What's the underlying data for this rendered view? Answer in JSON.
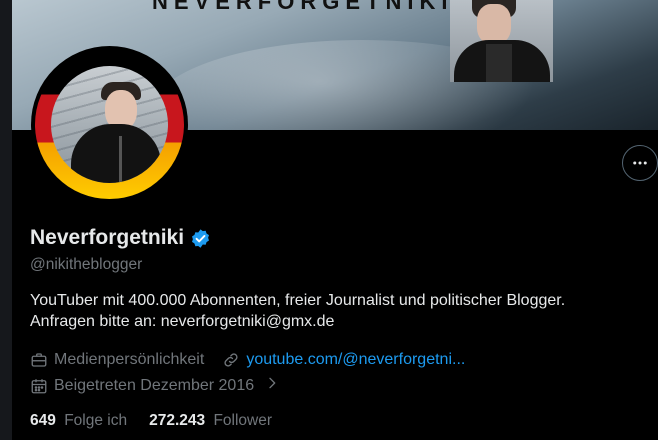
{
  "banner": {
    "text": "NEVERFORGETNIKI"
  },
  "profile": {
    "name": "Neverforgetniki",
    "verified": true,
    "handle": "@nikitheblogger",
    "bio_line1": "YouTuber mit 400.000 Abonnenten, freier Journalist und politischer Blogger.",
    "bio_line2": "Anfragen bitte an: neverforgetniki@gmx.de",
    "category": "Medienpersönlichkeit",
    "website": "youtube.com/@neverforgetni...",
    "joined": "Beigetreten Dezember 2016",
    "following_count": "649",
    "following_label": "Folge ich",
    "followers_count": "272.243",
    "followers_label": "Follower"
  },
  "colors": {
    "background": "#000000",
    "text_primary": "#e7e9ea",
    "text_secondary": "#71767b",
    "link": "#1d9bf0",
    "verified_badge": "#1d9bf0",
    "border": "#536471"
  },
  "icons": {
    "more": "more-dots-icon",
    "verified": "verified-badge-icon",
    "category": "briefcase-icon",
    "website": "link-icon",
    "joined": "calendar-icon",
    "chevron": "chevron-right-icon"
  }
}
